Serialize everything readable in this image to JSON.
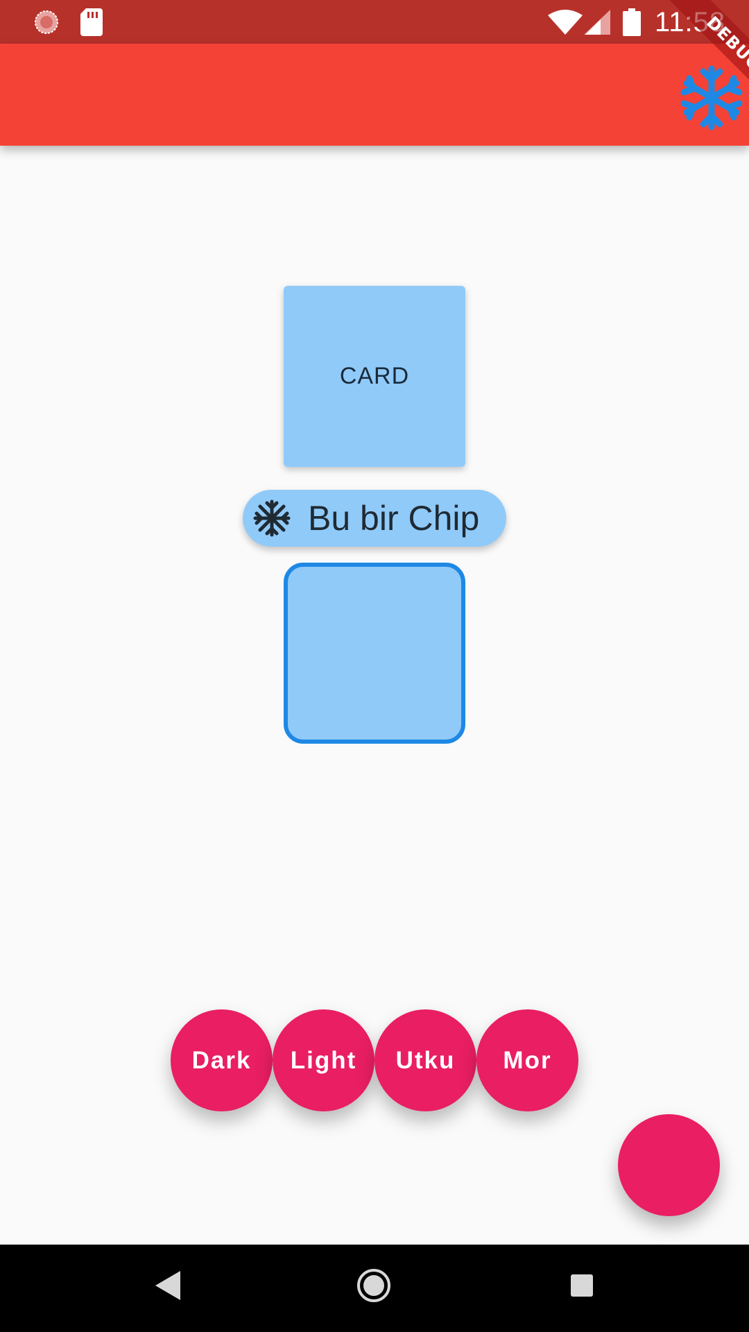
{
  "status_bar": {
    "time": "11:58",
    "icons": [
      "loading-icon",
      "sd-card-icon",
      "wifi-icon",
      "cell-signal-icon",
      "battery-icon"
    ]
  },
  "app_bar": {
    "background": "#f44336",
    "action_icon": "snowflake-icon",
    "action_color": "#1e88e5"
  },
  "debug_ribbon": {
    "label": "DEBUG"
  },
  "card": {
    "label": "CARD",
    "color": "#90caf9"
  },
  "chip": {
    "icon": "snowflake-icon",
    "label": "Bu bir Chip"
  },
  "outlined_box": {
    "fill": "#90caf9",
    "border": "#1e88e5"
  },
  "theme_buttons": {
    "dark": "Dark",
    "light": "Light",
    "utku": "Utku",
    "mor": "Mor",
    "color": "#e91e63"
  },
  "fab": {
    "color": "#e91e63"
  },
  "nav_bar": {
    "icons": [
      "back-icon",
      "home-icon",
      "recents-icon"
    ]
  }
}
